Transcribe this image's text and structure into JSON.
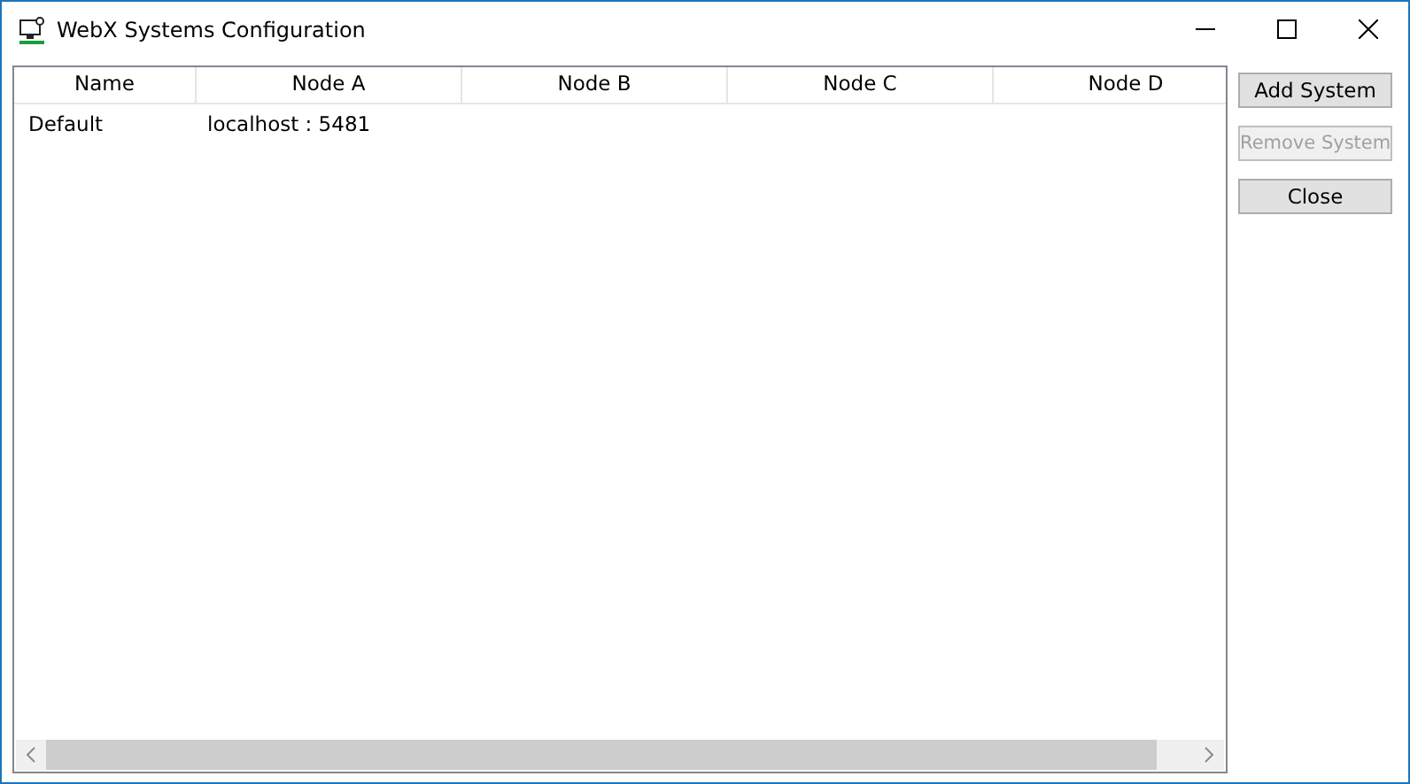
{
  "window": {
    "title": "WebX Systems Configuration"
  },
  "table": {
    "columns": [
      "Name",
      "Node A",
      "Node B",
      "Node C",
      "Node D"
    ],
    "rows": [
      [
        "Default",
        "localhost : 5481",
        "",
        "",
        ""
      ]
    ]
  },
  "buttons": [
    {
      "label": "Add System",
      "disabled": false
    },
    {
      "label": "Remove System",
      "disabled": true
    },
    {
      "label": "Close",
      "disabled": false
    }
  ]
}
